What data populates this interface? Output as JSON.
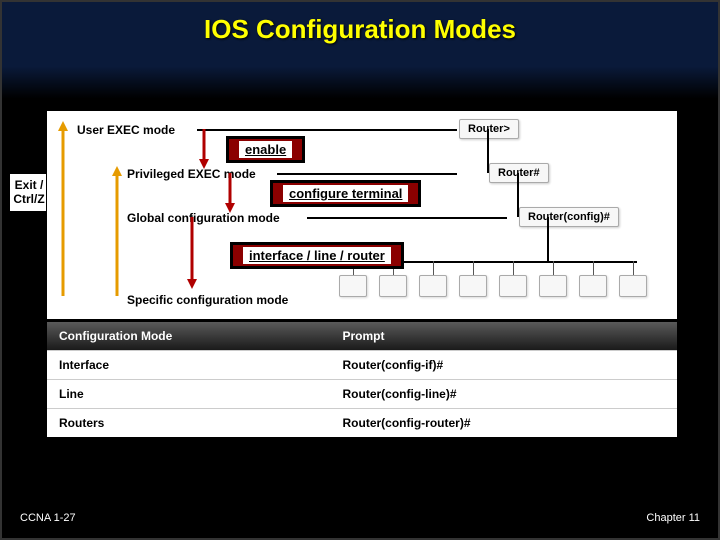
{
  "title": "IOS Configuration Modes",
  "exit_label_line1": "Exit /",
  "exit_label_line2": "Ctrl/Z",
  "modes": {
    "user": {
      "label": "User EXEC mode",
      "prompt": "Router>"
    },
    "priv": {
      "label": "Privileged EXEC mode",
      "prompt": "Router#"
    },
    "global": {
      "label": "Global configuration mode",
      "prompt": "Router(config)#"
    },
    "specific": {
      "label": "Specific configuration mode"
    }
  },
  "commands": {
    "enable": "enable",
    "configure": "configure terminal",
    "interface": "interface / line / router"
  },
  "table": {
    "head": {
      "mode": "Configuration Mode",
      "prompt": "Prompt"
    },
    "rows": [
      {
        "mode": "Interface",
        "prompt": "Router(config-if)#"
      },
      {
        "mode": "Line",
        "prompt": "Router(config-line)#"
      },
      {
        "mode": "Routers",
        "prompt": "Router(config-router)#"
      }
    ]
  },
  "footer": {
    "left": "CCNA 1-27",
    "right": "Chapter 11"
  }
}
